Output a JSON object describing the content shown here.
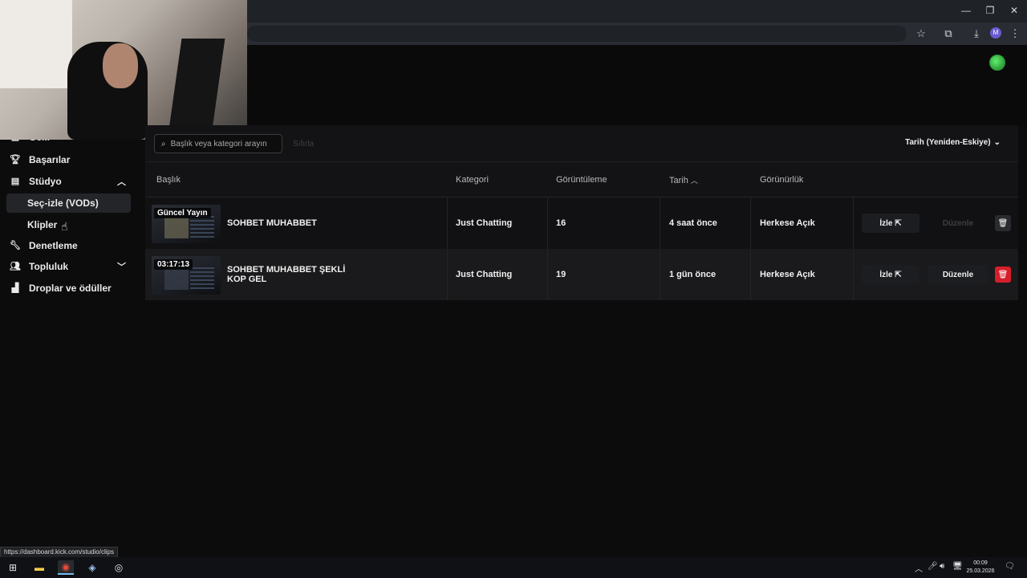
{
  "browser": {
    "window_controls": [
      "—",
      "❐",
      "✕"
    ],
    "profile_initial": "M"
  },
  "sidebar": {
    "partial_item": "Gelir",
    "items": [
      {
        "label": "Başarılar",
        "icon": "trophy-icon"
      },
      {
        "label": "Stüdyo",
        "icon": "film-icon",
        "expanded": true
      },
      {
        "label": "Denetleme",
        "icon": "wrench-icon"
      },
      {
        "label": "Topluluk",
        "icon": "users-icon",
        "expanded": false
      },
      {
        "label": "Droplar ve ödüller",
        "icon": "chart-icon"
      }
    ],
    "studio_sub": [
      {
        "label": "Seç-izle (VODs)",
        "active": true
      },
      {
        "label": "Klipler",
        "active": false
      }
    ]
  },
  "toolbar": {
    "search_placeholder": "Başlık veya kategori arayın",
    "reset_label": "Sıfırla",
    "sort_label": "Tarih (Yeniden-Eskiye)"
  },
  "table": {
    "headers": {
      "title": "Başlık",
      "category": "Kategori",
      "views": "Görüntüleme",
      "date": "Tarih",
      "visibility": "Görünürlük"
    },
    "rows": [
      {
        "badge": "Güncel Yayın",
        "title": "SOHBET MUHABBET",
        "category": "Just Chatting",
        "views": "16",
        "date": "4 saat önce",
        "visibility": "Herkese Açık",
        "watch": "İzle",
        "edit": "Düzenle",
        "edit_enabled": false
      },
      {
        "badge": "03:17:13",
        "title": "SOHBET MUHABBET ŞEKLİ KOP GEL",
        "category": "Just Chatting",
        "views": "19",
        "date": "1 gün önce",
        "visibility": "Herkese Açık",
        "watch": "İzle",
        "edit": "Düzenle",
        "edit_enabled": true
      }
    ]
  },
  "status_url": "https://dashboard.kick.com/studio/clips",
  "taskbar": {
    "time": "00:09",
    "date": "25.03.2026"
  },
  "colors": {
    "delete_red": "#d61f2c",
    "background": "#0c0c0d"
  }
}
